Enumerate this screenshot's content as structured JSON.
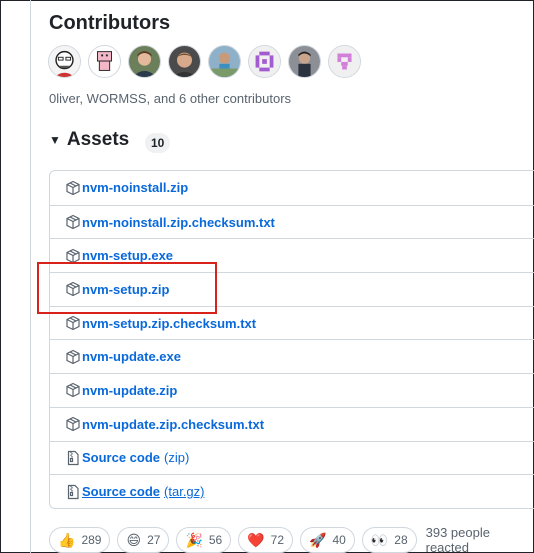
{
  "contributors": {
    "title": "Contributors",
    "summary": "0liver, WORMSS, and 6 other contributors",
    "avatars": [
      "avatar-1",
      "avatar-2",
      "avatar-3",
      "avatar-4",
      "avatar-5",
      "avatar-6",
      "avatar-7",
      "avatar-8"
    ]
  },
  "assets": {
    "title": "Assets",
    "count": "10",
    "items": [
      {
        "name": "nvm-noinstall.zip",
        "icon": "package-icon"
      },
      {
        "name": "nvm-noinstall.zip.checksum.txt",
        "icon": "package-icon"
      },
      {
        "name": "nvm-setup.exe",
        "icon": "package-icon"
      },
      {
        "name": "nvm-setup.zip",
        "icon": "package-icon"
      },
      {
        "name": "nvm-setup.zip.checksum.txt",
        "icon": "package-icon"
      },
      {
        "name": "nvm-update.exe",
        "icon": "package-icon"
      },
      {
        "name": "nvm-update.zip",
        "icon": "package-icon"
      },
      {
        "name": "nvm-update.zip.checksum.txt",
        "icon": "package-icon"
      },
      {
        "name": "Source code",
        "suffix": "(zip)",
        "icon": "file-zip-icon"
      },
      {
        "name": "Source code",
        "suffix": "(tar.gz)",
        "icon": "file-zip-icon"
      }
    ]
  },
  "reactions": {
    "items": [
      {
        "emoji": "👍",
        "count": "289",
        "name": "thumbs-up"
      },
      {
        "emoji": "😄",
        "count": "27",
        "name": "laugh"
      },
      {
        "emoji": "🎉",
        "count": "56",
        "name": "hooray"
      },
      {
        "emoji": "❤️",
        "count": "72",
        "name": "heart"
      },
      {
        "emoji": "🚀",
        "count": "40",
        "name": "rocket"
      },
      {
        "emoji": "👀",
        "count": "28",
        "name": "eyes"
      }
    ],
    "summary": "393 people reacted"
  },
  "colors": {
    "link": "#0969da",
    "highlight": "#d9221c",
    "border": "#d0d7de"
  }
}
